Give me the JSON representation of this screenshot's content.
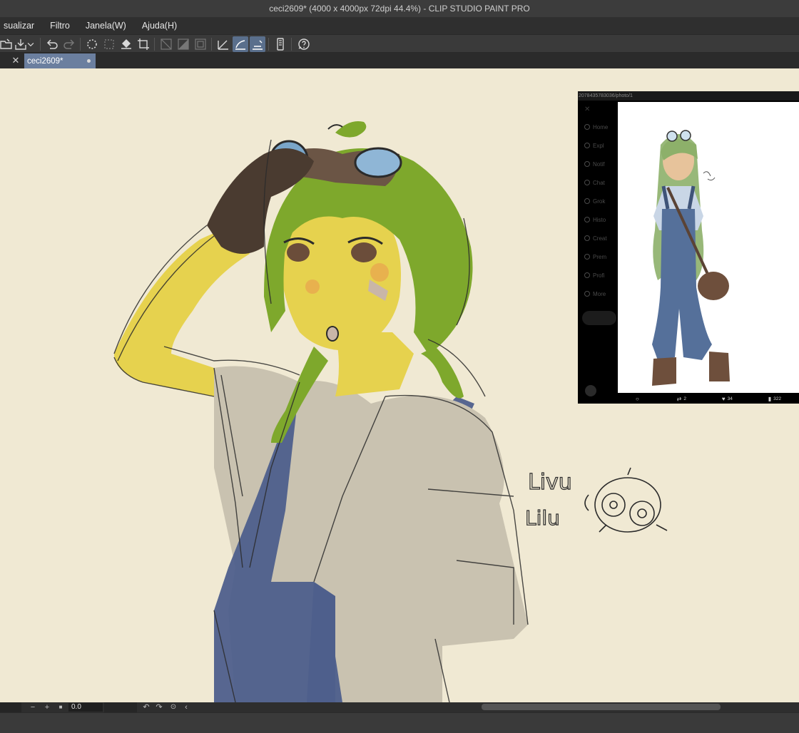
{
  "window": {
    "title": "ceci2609* (4000 x 4000px 72dpi 44.4%)  - CLIP STUDIO PAINT PRO"
  },
  "menu": {
    "items": [
      "sualizar",
      "Filtro",
      "Janela(W)",
      "Ajuda(H)"
    ]
  },
  "toolbar": {
    "buttons": [
      {
        "name": "open-file-icon",
        "state": "normal"
      },
      {
        "name": "save-icon",
        "state": "normal"
      },
      {
        "name": "chevron-down-icon",
        "state": "normal"
      },
      {
        "name": "undo-icon",
        "state": "normal"
      },
      {
        "name": "redo-icon",
        "state": "dim"
      },
      {
        "name": "select-all-icon",
        "state": "normal"
      },
      {
        "name": "deselect-icon",
        "state": "dim"
      },
      {
        "name": "fill-icon",
        "state": "normal"
      },
      {
        "name": "transform-icon",
        "state": "normal"
      },
      {
        "name": "ruler-off-icon",
        "state": "dim"
      },
      {
        "name": "ruler-half-icon",
        "state": "dim"
      },
      {
        "name": "frame-icon",
        "state": "dim"
      },
      {
        "name": "snap-ruler-icon",
        "state": "normal"
      },
      {
        "name": "snap-grid-icon",
        "state": "active"
      },
      {
        "name": "snap-special-icon",
        "state": "active"
      },
      {
        "name": "device-icon",
        "state": "normal"
      },
      {
        "name": "help-icon",
        "state": "normal"
      }
    ]
  },
  "tabs": [
    {
      "label": "ceci2609*",
      "modified": true
    }
  ],
  "reference_window": {
    "url": "2078435783036/photo/1",
    "nav": [
      "Home",
      "Expl",
      "Notif",
      "Chat",
      "Grok",
      "Histo",
      "Creat",
      "Prem",
      "Profi",
      "More"
    ],
    "stats": {
      "replies": "",
      "reposts": "2",
      "likes": "34",
      "views": "322"
    }
  },
  "canvas": {
    "handwritten_text_1": "Livu",
    "handwritten_text_2": "Lilu",
    "background_color": "#f0e9d3"
  },
  "bottom_bar": {
    "zoom_value": "0.0",
    "buttons": [
      "minus-icon",
      "plus-icon",
      "stop-icon",
      "rotate-left-icon",
      "rotate-right-icon",
      "reset-rotation-icon",
      "chevron-left-icon"
    ]
  },
  "colors": {
    "hair": "#7ea82c",
    "skin": "#e6d24e",
    "shirt": "#c9c2b0",
    "overalls": "#4e5f8c",
    "glove": "#4a3b30",
    "accent_tab": "#6b7f9f"
  }
}
